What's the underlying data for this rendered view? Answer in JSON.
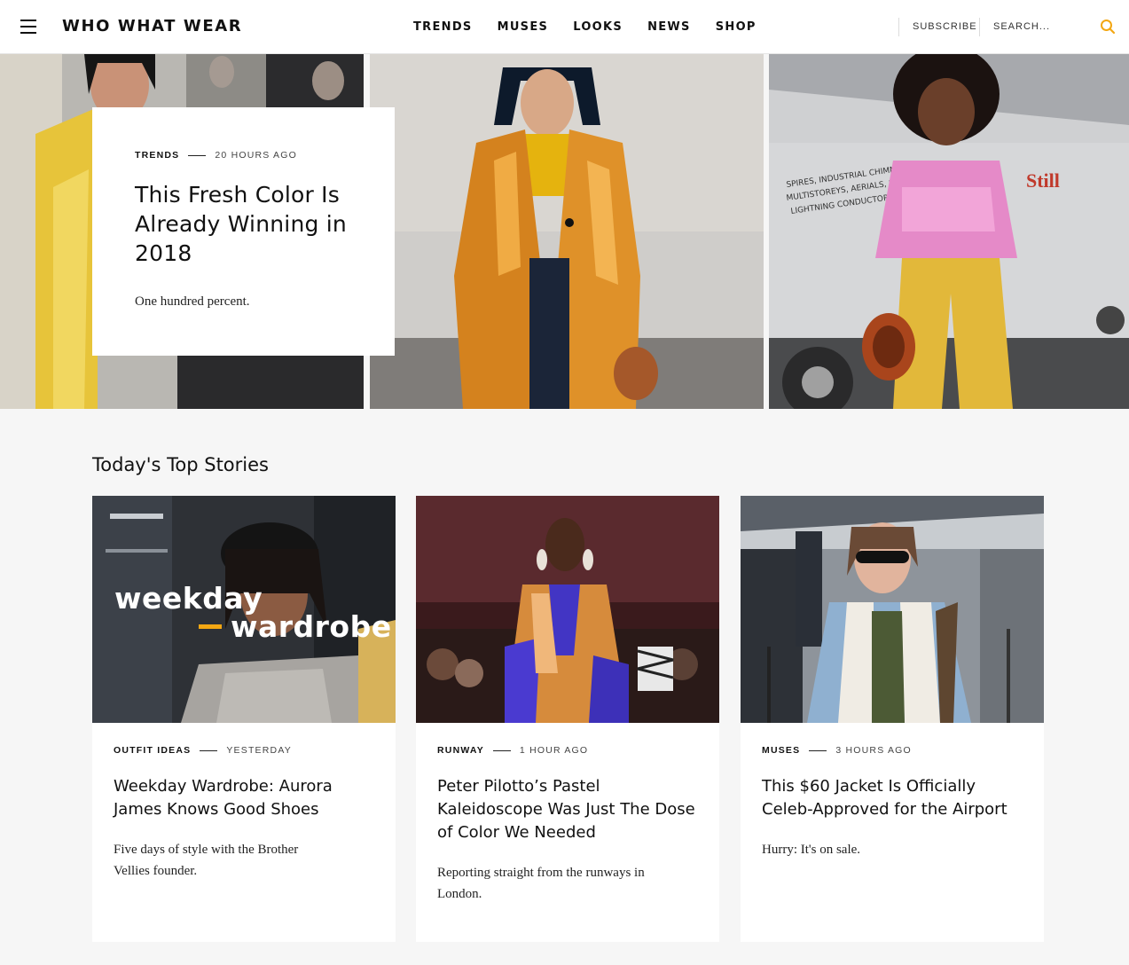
{
  "brand": {
    "logo": "WHO WHAT WEAR",
    "accent": "#f3a713"
  },
  "nav": {
    "items": [
      "TRENDS",
      "MUSES",
      "LOOKS",
      "NEWS",
      "SHOP"
    ]
  },
  "header": {
    "subscribe": "SUBSCRIBE",
    "search_placeholder": "SEARCH..."
  },
  "hero": {
    "category": "TRENDS",
    "time": "20 HOURS AGO",
    "title": "This Fresh Color Is Already Winning in 2018",
    "dek": "One hundred percent."
  },
  "section": {
    "title": "Today's Top Stories"
  },
  "cards": [
    {
      "category": "OUTFIT IDEAS",
      "time": "YESTERDAY",
      "title": "Weekday Wardrobe: Aurora James Knows Good Shoes",
      "dek": "Five days of style with the Brother Vellies founder.",
      "overlay_line1": "weekday",
      "overlay_line2": "wardrobe"
    },
    {
      "category": "RUNWAY",
      "time": "1 HOUR AGO",
      "title": "Peter Pilotto’s Pastel Kaleidoscope Was Just The Dose of Color We Needed",
      "dek": "Reporting straight from the runways in London."
    },
    {
      "category": "MUSES",
      "time": "3 HOURS AGO",
      "title": "This $60 Jacket Is Officially Celeb-Approved for the Airport",
      "dek": "Hurry: It's on sale."
    }
  ]
}
